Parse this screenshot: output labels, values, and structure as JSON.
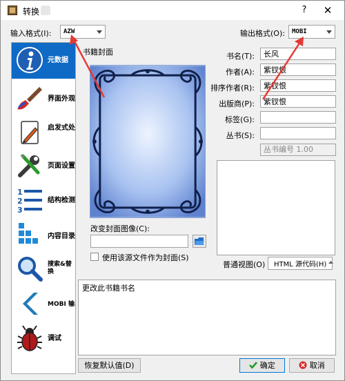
{
  "window": {
    "title": "转换",
    "help_label": "?",
    "close_label": "✕"
  },
  "input_format": {
    "label": "输入格式(I):",
    "value": "AZW"
  },
  "output_format": {
    "label": "输出格式(O):",
    "value": "MOBI"
  },
  "sidebar": {
    "items": [
      {
        "label": "元数据",
        "icon": "info-icon"
      },
      {
        "label": "界面外观",
        "icon": "paintbrush-icon"
      },
      {
        "label": "启发式处理",
        "icon": "heuristics-icon"
      },
      {
        "label": "页面设置",
        "icon": "tools-icon"
      },
      {
        "label": "结构检测",
        "icon": "numbered-list-icon"
      },
      {
        "label": "内容目录",
        "icon": "toc-icon"
      },
      {
        "label": "搜索&替换",
        "icon": "magnifier-icon"
      },
      {
        "label": "MOBI 输出",
        "icon": "chevron-left-icon"
      },
      {
        "label": "调试",
        "icon": "bug-icon"
      }
    ]
  },
  "cover": {
    "heading": "书籍封面",
    "change_label": "改变封面图像(C):",
    "path_value": "",
    "use_source_label": "使用该源文件作为封面(S)"
  },
  "metadata": {
    "title_label": "书名(T):",
    "title_value": "长风",
    "author_label": "作者(A):",
    "author_value": "紫钗恨",
    "author_sort_label": "排序作者(R):",
    "author_sort_value": "紫钗恨",
    "publisher_label": "出版商(P):",
    "publisher_value": "紫钗恨",
    "tags_label": "标签(G):",
    "tags_value": "",
    "series_label": "丛书(S):",
    "series_value": "",
    "series_index_value": "丛书编号 1.00"
  },
  "comment_tabs": {
    "normal_label": "普通视图(O)",
    "html_label": "HTML 源代码(H)"
  },
  "description": {
    "text": "更改此书籍书名"
  },
  "buttons": {
    "restore_label": "恢复默认值(D)",
    "ok_label": "确定",
    "cancel_label": "取消"
  },
  "colors": {
    "sidebar_active": "#0f6ac6",
    "annotation_arrow": "#e53935"
  }
}
